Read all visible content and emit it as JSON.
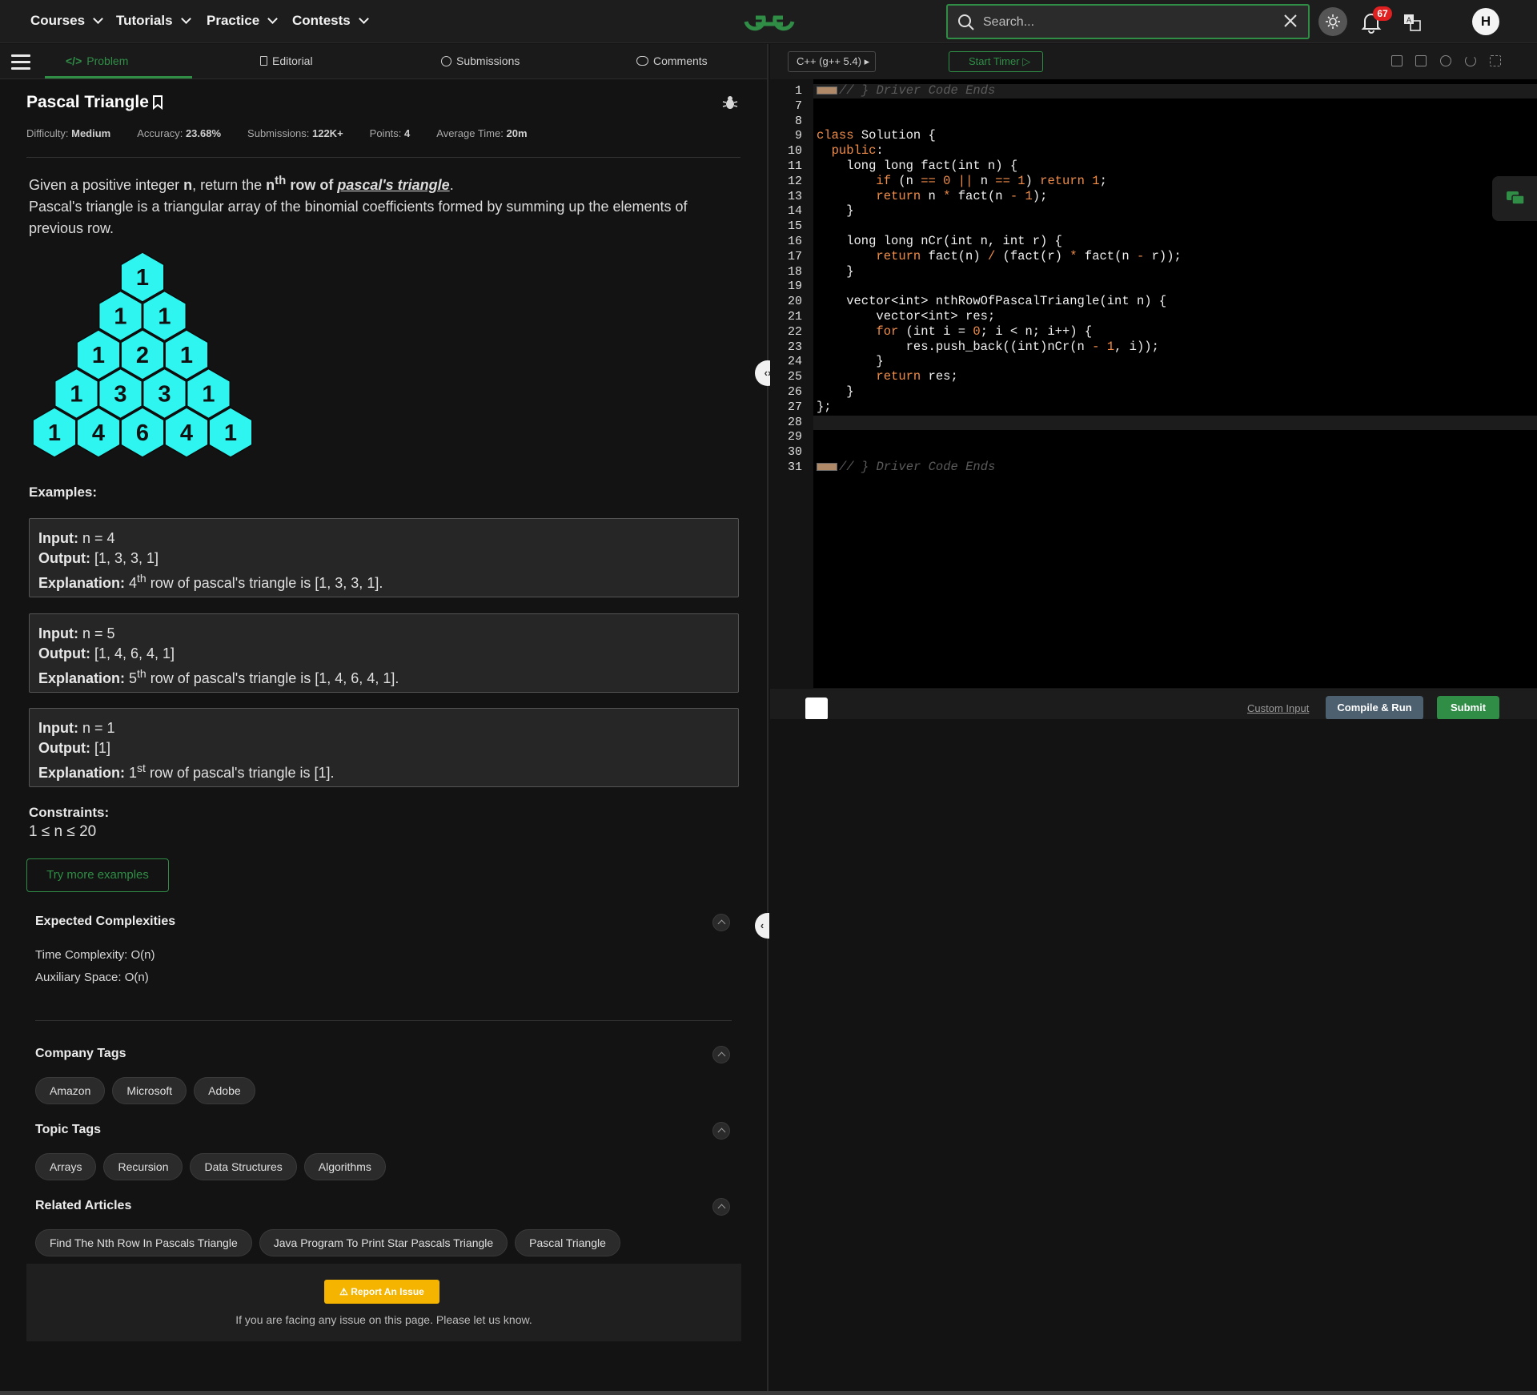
{
  "nav": {
    "items": [
      "Courses",
      "Tutorials",
      "Practice",
      "Contests"
    ],
    "search_placeholder": "Search...",
    "notification_count": "67",
    "avatar_initial": "H"
  },
  "tabs": [
    "Problem",
    "Editorial",
    "Submissions",
    "Comments"
  ],
  "problem": {
    "title": "Pascal Triangle",
    "meta": {
      "difficulty_label": "Difficulty:",
      "difficulty": "Medium",
      "accuracy_label": "Accuracy:",
      "accuracy": "23.68%",
      "submissions_label": "Submissions:",
      "submissions": "122K+",
      "points_label": "Points:",
      "points": "4",
      "avg_time_label": "Average Time:",
      "avg_time": "20m"
    },
    "desc_p1_a": "Given a positive integer ",
    "desc_p1_n": "n",
    "desc_p1_b": ", return the ",
    "desc_p1_nth": "n",
    "desc_p1_sup": "th",
    "desc_p1_c": " row of ",
    "desc_p1_link": "pascal's triangle",
    "desc_p1_d": ".",
    "desc_p2": "Pascal's triangle is a triangular array of the binomial coefficients formed by summing up the elements of previous row.",
    "triangle": [
      [
        "1"
      ],
      [
        "1",
        "1"
      ],
      [
        "1",
        "2",
        "1"
      ],
      [
        "1",
        "3",
        "3",
        "1"
      ],
      [
        "1",
        "4",
        "6",
        "4",
        "1"
      ]
    ],
    "examples_label": "Examples:",
    "examples": [
      {
        "input": "n = 4",
        "output": "[1, 3, 3, 1]",
        "exp_num": "4",
        "exp_sup": "th",
        "exp_rest": "row of pascal's triangle is [1, 3, 3, 1]."
      },
      {
        "input": "n = 5",
        "output": "[1, 4, 6, 4, 1]",
        "exp_num": "5",
        "exp_sup": "th",
        "exp_rest": "row of pascal's triangle is [1, 4, 6, 4, 1]."
      },
      {
        "input": "n = 1",
        "output": "[1]",
        "exp_num": "1",
        "exp_sup": "st",
        "exp_rest": "row of pascal's triangle is [1]."
      }
    ],
    "labels": {
      "input": "Input:",
      "output": "Output:",
      "explanation": "Explanation:"
    },
    "constraints_label": "Constraints:",
    "constraints": "1 ≤ n ≤ 20",
    "try_more": "Try more examples",
    "complexities_label": "Expected Complexities",
    "time_complexity": "Time Complexity: O(n)",
    "aux_space": "Auxiliary Space: O(n)",
    "company_tags_label": "Company Tags",
    "company_tags": [
      "Amazon",
      "Microsoft",
      "Adobe"
    ],
    "topic_tags_label": "Topic Tags",
    "topic_tags": [
      "Arrays",
      "Recursion",
      "Data Structures",
      "Algorithms"
    ],
    "related_label": "Related Articles",
    "related": [
      "Find The Nth Row In Pascals Triangle",
      "Java Program To Print Star Pascals Triangle",
      "Pascal Triangle"
    ],
    "report_button": "Report An Issue",
    "report_text": "If you are facing any issue on this page. Please let us know."
  },
  "editor": {
    "language": "C++ (g++ 5.4)",
    "timer": "Start Timer",
    "custom_input": "Custom Input",
    "compile_run": "Compile & Run",
    "submit": "Submit",
    "lines": [
      {
        "n": "1",
        "t": "// } Driver Code Ends"
      },
      {
        "n": "7",
        "t": ""
      },
      {
        "n": "8",
        "t": ""
      },
      {
        "n": "9",
        "t": "class Solution {"
      },
      {
        "n": "10",
        "t": "  public:"
      },
      {
        "n": "11",
        "t": "    long long fact(int n) {"
      },
      {
        "n": "12",
        "t": "        if (n == 0 || n == 1) return 1;"
      },
      {
        "n": "13",
        "t": "        return n * fact(n - 1);"
      },
      {
        "n": "14",
        "t": "    }"
      },
      {
        "n": "15",
        "t": ""
      },
      {
        "n": "16",
        "t": "    long long nCr(int n, int r) {"
      },
      {
        "n": "17",
        "t": "        return fact(n) / (fact(r) * fact(n - r));"
      },
      {
        "n": "18",
        "t": "    }"
      },
      {
        "n": "19",
        "t": ""
      },
      {
        "n": "20",
        "t": "    vector<int> nthRowOfPascalTriangle(int n) {"
      },
      {
        "n": "21",
        "t": "        vector<int> res;"
      },
      {
        "n": "22",
        "t": "        for (int i = 0; i < n; i++) {"
      },
      {
        "n": "23",
        "t": "            res.push_back((int)nCr(n - 1, i));"
      },
      {
        "n": "24",
        "t": "        }"
      },
      {
        "n": "25",
        "t": "        return res;"
      },
      {
        "n": "26",
        "t": "    }"
      },
      {
        "n": "27",
        "t": "};"
      },
      {
        "n": "28",
        "t": ""
      },
      {
        "n": "29",
        "t": ""
      },
      {
        "n": "30",
        "t": ""
      },
      {
        "n": "31",
        "t": "// } Driver Code Ends"
      }
    ]
  },
  "colors": {
    "accent": "#2f8d46",
    "hex_cell": "#2ff5f0",
    "badge": "#e02020",
    "report": "#f4b400"
  }
}
